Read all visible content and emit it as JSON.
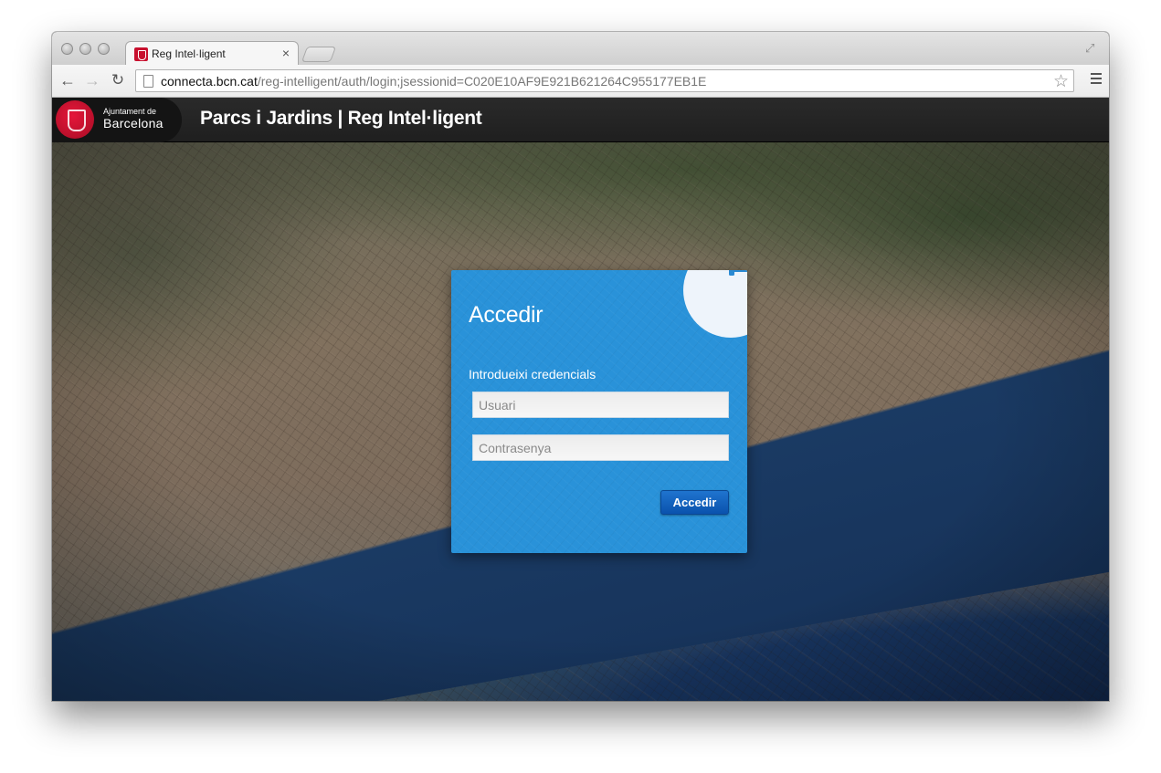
{
  "browser": {
    "tab_title": "Reg Intel·ligent",
    "tab_close": "×",
    "url_host": "connecta.bcn.cat",
    "url_path": "/reg-intelligent/auth/login;jsessionid=C020E10AF9E921B621264C955177EB1E",
    "icons": {
      "back": "←",
      "forward": "→",
      "reload": "↻",
      "star": "☆",
      "fullscreen": "⤢"
    }
  },
  "header": {
    "logo_small": "Ajuntament de",
    "logo_big": "Barcelona",
    "title": "Parcs i Jardins | Reg Intel·ligent"
  },
  "login": {
    "title": "Accedir",
    "subtitle": "Introdueixi credencials",
    "username_placeholder": "Usuari",
    "password_placeholder": "Contrasenya",
    "submit_label": "Accedir",
    "accent_color": "#2992d9",
    "button_color": "#1565c0",
    "icon": "water-tap-icon"
  }
}
